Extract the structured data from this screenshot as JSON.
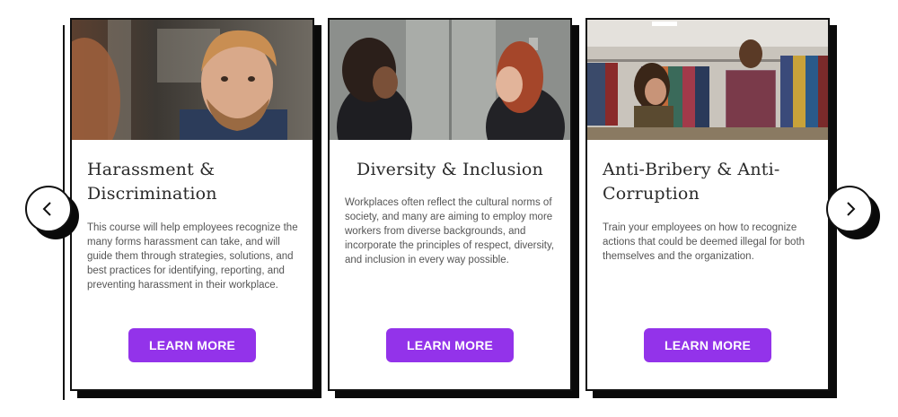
{
  "carousel": {
    "prev_icon": "chevron-left-icon",
    "next_icon": "chevron-right-icon",
    "accent_color": "#9333ea",
    "cards": [
      {
        "title": "Harassment & Discrimination",
        "description": "This course will help employees recognize the many forms harassment can take, and will guide them through strategies, solutions, and best practices for identifying, reporting, and preventing harassment in their workplace.",
        "button_label": "LEARN MORE"
      },
      {
        "title": "Diversity & Inclusion",
        "description": "Workplaces often reflect the cultural norms of society, and many are aiming to employ more workers from diverse backgrounds, and incorporate the principles of respect, diversity, and inclusion in every way possible.",
        "button_label": "LEARN MORE"
      },
      {
        "title": "Anti-Bribery & Anti-Corruption",
        "description": "Train your employees on how to recognize actions that could be deemed illegal for both themselves and the organization.",
        "button_label": "LEARN MORE"
      }
    ]
  }
}
